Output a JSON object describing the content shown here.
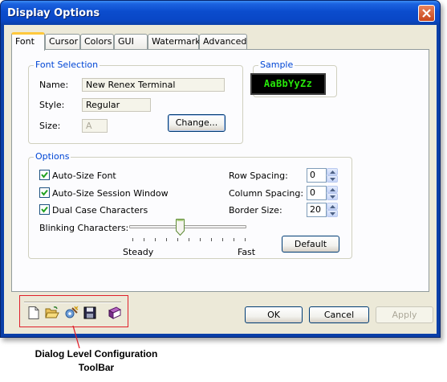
{
  "window": {
    "title": "Display Options"
  },
  "tabs": [
    {
      "label": "Font",
      "active": true
    },
    {
      "label": "Cursor"
    },
    {
      "label": "Colors"
    },
    {
      "label": "GUI"
    },
    {
      "label": "Watermark"
    },
    {
      "label": "Advanced"
    }
  ],
  "font_selection": {
    "legend": "Font Selection",
    "name_label": "Name:",
    "name_value": "New Renex Terminal",
    "style_label": "Style:",
    "style_value": "Regular",
    "size_label": "Size:",
    "size_value": "A",
    "change_button": "Change..."
  },
  "sample": {
    "legend": "Sample",
    "text": "AaBbYyZz",
    "text_color": "#27e80a",
    "background": "#000000"
  },
  "options": {
    "legend": "Options",
    "auto_size_font": {
      "label": "Auto-Size Font",
      "checked": true
    },
    "auto_size_session": {
      "label": "Auto-Size Session Window",
      "checked": true
    },
    "dual_case": {
      "label": "Dual Case Characters",
      "checked": true
    },
    "row_spacing": {
      "label": "Row Spacing:",
      "value": "0"
    },
    "column_spacing": {
      "label": "Column Spacing:",
      "value": "0"
    },
    "border_size": {
      "label": "Border Size:",
      "value": "20"
    },
    "blinking_label": "Blinking Characters:",
    "blink_slider": {
      "min_label": "Steady",
      "max_label": "Fast",
      "level": 0.45
    },
    "default_button": "Default"
  },
  "toolbar": {
    "icons": [
      "new-document-icon",
      "open-folder-icon",
      "settings-wizard-icon",
      "save-icon",
      "book-icon"
    ]
  },
  "buttons": {
    "ok": "OK",
    "cancel": "Cancel",
    "apply": "Apply"
  },
  "annotation": {
    "line1": "Dialog Level Configuration",
    "line2": "ToolBar",
    "color": "#e0202a"
  }
}
